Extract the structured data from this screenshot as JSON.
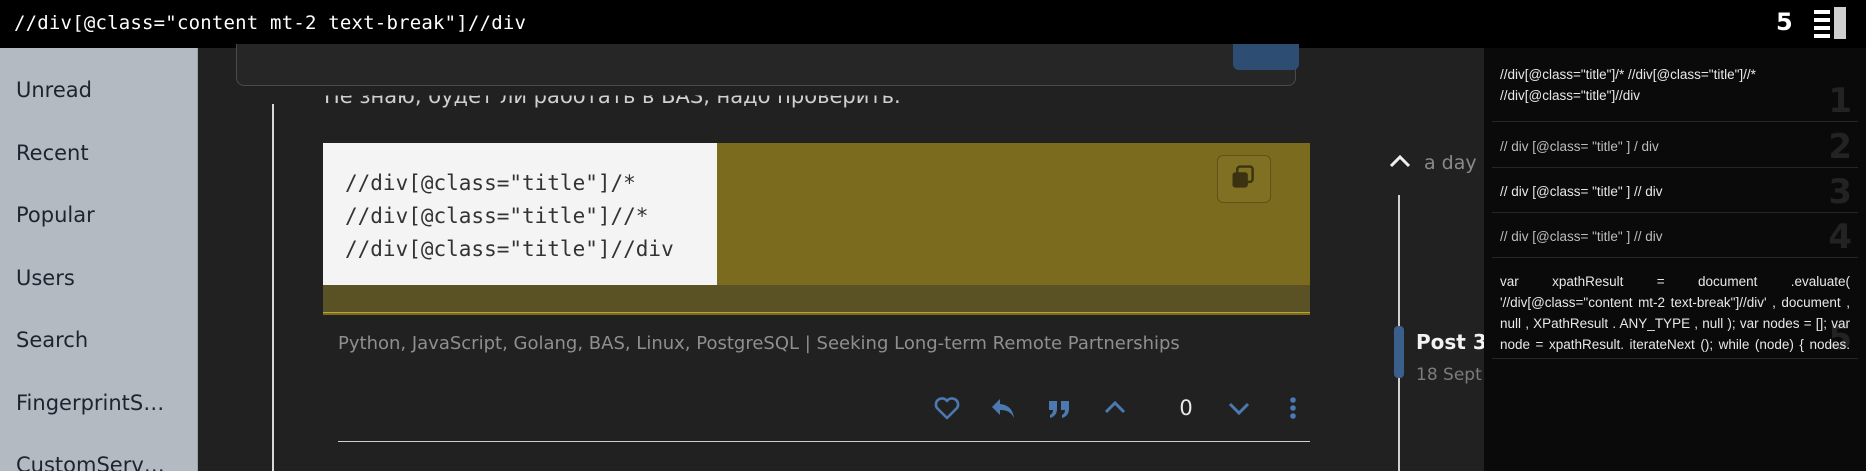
{
  "search_bar": {
    "query": "//div[@class=\"content mt-2 text-break\"]//div",
    "match_count": "5"
  },
  "sidebar": {
    "items": [
      {
        "label": "Unread"
      },
      {
        "label": "Recent"
      },
      {
        "label": "Popular"
      },
      {
        "label": "Users"
      },
      {
        "label": "Search"
      },
      {
        "label": "FingerprintS…"
      },
      {
        "label": "CustomServ…"
      }
    ]
  },
  "post": {
    "partial_text": "Не знаю, будет ли работать в BAS, надо проверить.",
    "code_lines": [
      "//div[@class=\"title\"]/*",
      "//div[@class=\"title\"]//*",
      "//div[@class=\"title\"]//div"
    ],
    "signature": "Python, JavaScript, Golang, BAS, Linux, PostgreSQL | Seeking Long-term Remote Partnerships",
    "vote_count": "0"
  },
  "timeline": {
    "top_label": "a day",
    "post_label": "Post 3",
    "post_date": "18 Sept"
  },
  "results": [
    {
      "num": "1",
      "text": "//div[@class=\"title\"]/*          //div[@class=\"title\"]//*\n//div[@class=\"title\"]//div"
    },
    {
      "num": "2",
      "text": "// div [@class= \"title\" ] / div"
    },
    {
      "num": "3",
      "text": "// div [@class= \"title\" ] // div"
    },
    {
      "num": "4",
      "text": "// div [@class= \"title\" ] // div"
    },
    {
      "num": "5",
      "text": "var xpathResult = document .evaluate( '//div[@class=\"content mt-2 text-break\"]//div' , document , null , XPathResult . ANY_TYPE , null ); var nodes = []; var node = xpathResult. iterateNext (); while (node) { nodes. push (node); node ="
    }
  ],
  "colors": {
    "sidebar_bg": "#b3bac2",
    "main_bg": "#212121",
    "code_bg": "#7a6b1f",
    "accent_blue": "#3a5f8a",
    "results_bg": "#0a0a0a"
  },
  "icons": {
    "list_toggle": "list-icon",
    "copy": "copy-icon",
    "like": "heart-icon",
    "reply": "reply-icon",
    "quote": "quote-icon",
    "upvote": "chevron-up-icon",
    "downvote": "chevron-down-icon",
    "more": "more-vertical-icon"
  }
}
